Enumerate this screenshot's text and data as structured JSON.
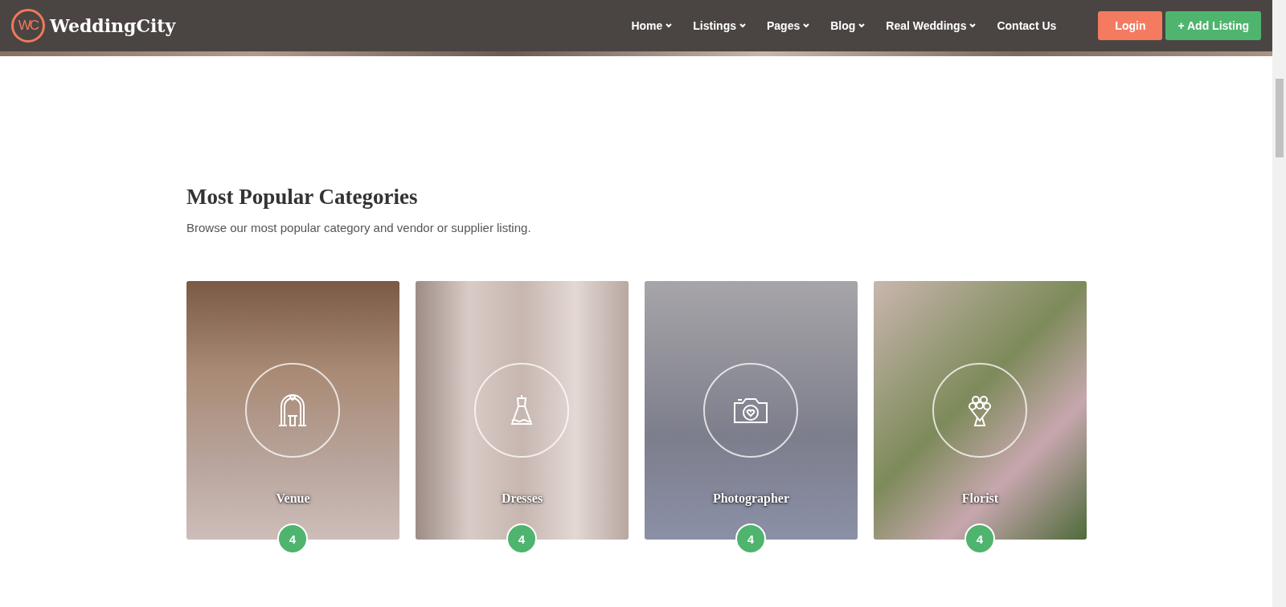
{
  "header": {
    "logo_mark": "WC",
    "brand": "WeddingCity",
    "nav": [
      {
        "label": "Home",
        "has_menu": true
      },
      {
        "label": "Listings",
        "has_menu": true
      },
      {
        "label": "Pages",
        "has_menu": true
      },
      {
        "label": "Blog",
        "has_menu": true
      },
      {
        "label": "Real Weddings",
        "has_menu": true
      },
      {
        "label": "Contact Us",
        "has_menu": false
      }
    ],
    "buttons": [
      {
        "label": "Login",
        "kind": "login"
      },
      {
        "label": "+ Add Listing",
        "kind": "add"
      }
    ]
  },
  "section": {
    "title": "Most Popular Categories",
    "subtitle": "Browse our most popular category and vendor or supplier listing.",
    "categories": [
      {
        "name": "Venue",
        "kind": "venue",
        "count": "4"
      },
      {
        "name": "Dresses",
        "kind": "dress",
        "count": "4"
      },
      {
        "name": "Photographer",
        "kind": "camera",
        "count": "4"
      },
      {
        "name": "Florist",
        "kind": "bouquet",
        "count": "4"
      }
    ]
  }
}
